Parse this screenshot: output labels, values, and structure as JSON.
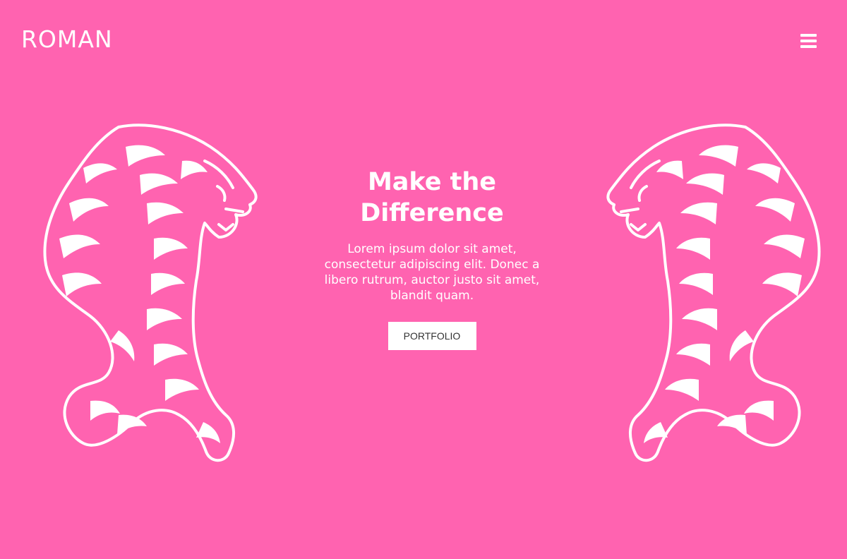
{
  "header": {
    "logo_text": "ROMAN",
    "menu_icon": "hamburger-menu-icon"
  },
  "hero": {
    "title_line1": "Make the",
    "title_line2": "Difference",
    "description": "Lorem ipsum dolor sit amet, consectetur adipiscing elit. Donec a libero rutrum, auctor justo sit amet, blandit quam.",
    "button_label": "PORTFOLIO"
  },
  "decor": {
    "left_image": "tiger-illustration",
    "right_image": "tiger-illustration"
  },
  "colors": {
    "background": "#ff63b0",
    "foreground": "#ffffff",
    "button_text": "#333333"
  }
}
